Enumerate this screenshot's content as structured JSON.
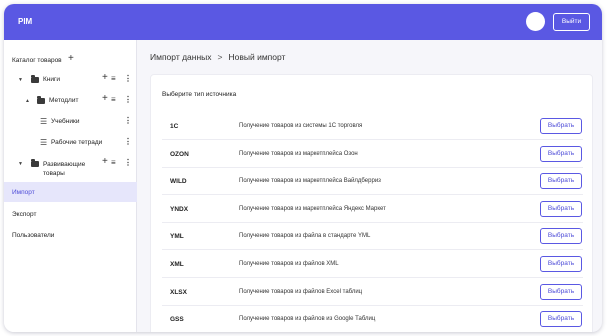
{
  "header": {
    "brand": "PIM",
    "logout_label": "Выйти"
  },
  "sidebar": {
    "catalog_title": "Каталог товаров",
    "catalog_add": "+",
    "tree": [
      {
        "label": "Книги"
      },
      {
        "label": "Методлит"
      },
      {
        "label": "Учебники"
      },
      {
        "label": "Рабочие тетради"
      },
      {
        "label": "Развивающие товары"
      }
    ],
    "nav": [
      {
        "label": "Импорт",
        "active": true
      },
      {
        "label": "Экспорт"
      },
      {
        "label": "Пользователи"
      }
    ]
  },
  "breadcrumb": {
    "parent": "Импорт данных",
    "separator": ">",
    "current": "Новый импорт"
  },
  "panel": {
    "title": "Выберите тип источника",
    "select_label": "Выбрать",
    "sources": [
      {
        "code": "1C",
        "description": "Получение товаров из системы 1С торговля"
      },
      {
        "code": "OZON",
        "description": "Получение товаров из маркетплейса Озон"
      },
      {
        "code": "WILD",
        "description": "Получение товаров из маркетплейса Вайлдберриз"
      },
      {
        "code": "YNDX",
        "description": "Получение товаров из маркетплейса Яндекс Маркет"
      },
      {
        "code": "YML",
        "description": "Получение товаров из файла в стандарте YML"
      },
      {
        "code": "XML",
        "description": "Получение товаров из файлов XML"
      },
      {
        "code": "XLSX",
        "description": "Получение товаров из файлов Excel таблиц"
      },
      {
        "code": "GSS",
        "description": "Получение товаров из файлов из Google Таблиц"
      }
    ]
  },
  "colors": {
    "accent": "#5a58e3",
    "active_nav_bg": "#e6e6fb",
    "page_bg": "#f6f6fa"
  },
  "icons": [
    "plus-icon",
    "caret-down-icon",
    "folder-icon",
    "sort-list-icon",
    "more-vertical-icon",
    "list-icon",
    "chevron-right-icon"
  ]
}
